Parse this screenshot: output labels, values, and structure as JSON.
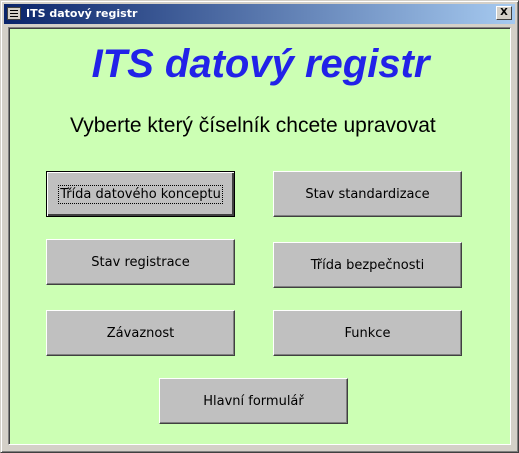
{
  "window": {
    "title": "ITS datový registr",
    "close_label": "X"
  },
  "form": {
    "heading": "ITS datový registr",
    "instruction": "Vyberte který číselník chcete upravovat",
    "buttons": {
      "trida_konceptu": "Třída datového konceptu",
      "stav_standardizace": "Stav standardizace",
      "stav_registrace": "Stav registrace",
      "trida_bezpecnosti": "Třída bezpečnosti",
      "zavaznost": "Závaznost",
      "funkce": "Funkce",
      "hlavni_formular": "Hlavní formulář"
    }
  },
  "colors": {
    "background": "#ccffb4",
    "heading": "#2222e8",
    "titlebar_start": "#0a246a",
    "titlebar_end": "#a6caf0"
  },
  "icons": {
    "window_icon": "form-icon",
    "close": "close-icon"
  }
}
